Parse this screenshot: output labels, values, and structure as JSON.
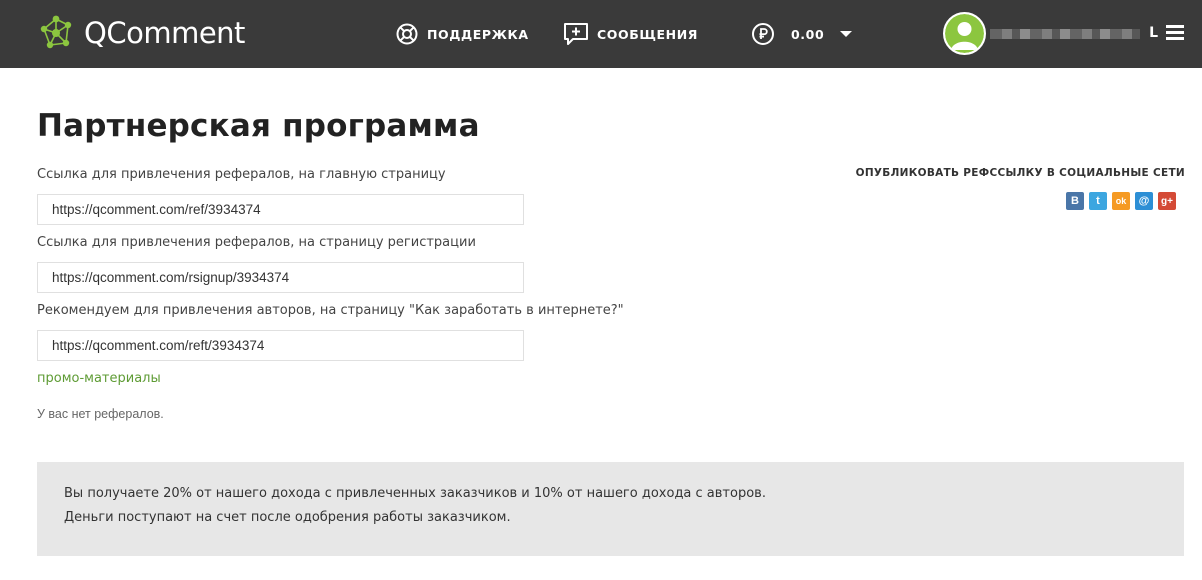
{
  "header": {
    "logo_text": "QComment",
    "nav": {
      "support_label": "ПОДДЕРЖКА",
      "messages_label": "СООБЩЕНИЯ",
      "balance_label": "0.00"
    },
    "username_tail": "L"
  },
  "main": {
    "title": "Партнерская программа",
    "fields": [
      {
        "label": "Ссылка для привлечения рефералов, на главную страницу",
        "value": "https://qcomment.com/ref/3934374"
      },
      {
        "label": "Ссылка для привлечения рефералов, на страницу регистрации",
        "value": "https://qcomment.com/rsignup/3934374"
      },
      {
        "label": "Рекомендуем для привлечения авторов, на страницу \"Как заработать в интернете?\"",
        "value": "https://qcomment.com/reft/3934374"
      }
    ],
    "promo_link": "промо-материалы",
    "no_referrals": "У вас нет рефералов."
  },
  "share": {
    "title": "ОПУБЛИКОВАТЬ РЕФССЫЛКУ В СОЦИАЛЬНЫЕ СЕТИ",
    "icons": [
      {
        "name": "vk-icon",
        "glyph": "B",
        "color": "#4a76a8"
      },
      {
        "name": "twitter-icon",
        "glyph": "t",
        "color": "#3ca6e0"
      },
      {
        "name": "odnoklassniki-icon",
        "glyph": "ok",
        "color": "#f59a23"
      },
      {
        "name": "mailru-icon",
        "glyph": "@",
        "color": "#2d8fd5"
      },
      {
        "name": "googleplus-icon",
        "glyph": "g+",
        "color": "#d44a36"
      }
    ]
  },
  "info": {
    "line1": "Вы получаете 20% от нашего дохода с привлеченных заказчиков и 10% от нашего дохода с авторов.",
    "line2": "Деньги поступают на счет после одобрения работы заказчиком."
  },
  "colors": {
    "header_bg": "#3a3a3a",
    "logo_green": "#8cc63f",
    "link_green": "#5e9b34",
    "info_bg": "#e7e7e7"
  }
}
